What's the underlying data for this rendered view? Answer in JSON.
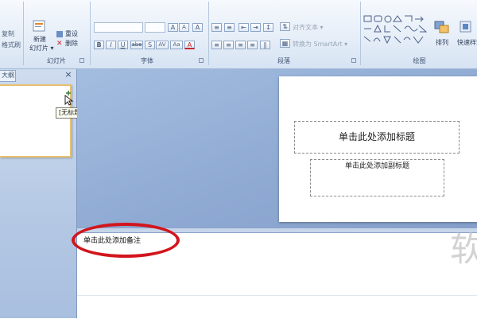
{
  "ribbon": {
    "groups": {
      "slides": "幻灯片",
      "font": "字体",
      "paragraph": "段落",
      "drawing": "绘图"
    },
    "clipboard": {
      "copy": "复制",
      "format_painter": "格式刷"
    },
    "slides_group": {
      "new_slide": "新建",
      "new_slide_sub": "幻灯片 ▾",
      "reset": "重设",
      "delete": "删除"
    },
    "font_group": {
      "row_buttons": [
        "B",
        "I",
        "U",
        "abe",
        "S",
        "AV",
        "Aa",
        "A"
      ],
      "grow_font": "A",
      "shrink_font": "A",
      "clear_format": "A"
    },
    "paragraph_group": {
      "align_text": "对齐文本 ▾",
      "convert_smartart": "转换为 SmartArt ▾"
    },
    "drawing_group": {
      "arrange": "排列",
      "quick_styles": "快速样式"
    }
  },
  "left_panel": {
    "tab_label": "大纲",
    "close_glyph": "×",
    "tooltip": "[无标题]"
  },
  "slide": {
    "title_placeholder": "单击此处添加标题",
    "subtitle_placeholder": "单击此处添加副标题"
  },
  "notes": {
    "placeholder": "单击此处添加备注"
  },
  "highlight_color": "#d2151d",
  "watermark": "软"
}
